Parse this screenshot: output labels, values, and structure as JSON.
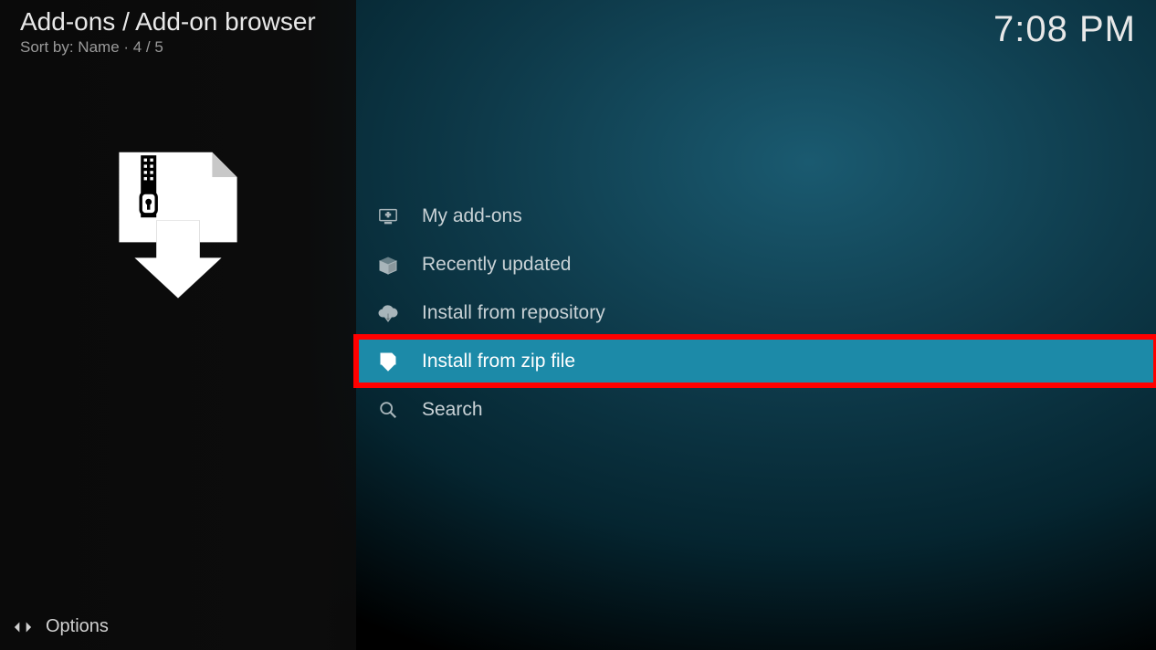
{
  "header": {
    "breadcrumb": "Add-ons / Add-on browser",
    "sort_label": "Sort by: Name  ·  4 / 5",
    "clock": "7:08 PM"
  },
  "footer": {
    "options_label": "Options"
  },
  "menu": {
    "items": [
      {
        "label": "My add-ons",
        "icon": "monitor-addon-icon",
        "selected": false
      },
      {
        "label": "Recently updated",
        "icon": "box-open-icon",
        "selected": false
      },
      {
        "label": "Install from repository",
        "icon": "cloud-download-icon",
        "selected": false
      },
      {
        "label": "Install from zip file",
        "icon": "zip-download-icon",
        "selected": true
      },
      {
        "label": "Search",
        "icon": "search-icon",
        "selected": false
      }
    ]
  }
}
